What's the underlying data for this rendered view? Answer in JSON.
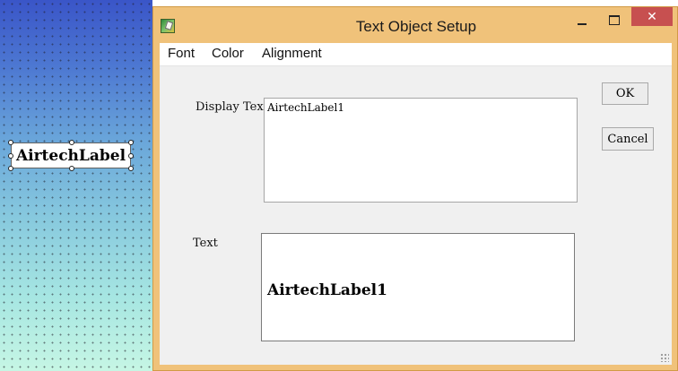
{
  "canvas": {
    "label_text": "AirtechLabel"
  },
  "window": {
    "title": "Text Object Setup",
    "close_glyph": "✕"
  },
  "menu": {
    "items": [
      "Font",
      "Color",
      "Alignment"
    ]
  },
  "form": {
    "display_text_label": "Display Text",
    "display_text_value": "AirtechLabel1",
    "text_label": "Text",
    "preview_value": "AirtechLabel1"
  },
  "buttons": {
    "ok": "OK",
    "cancel": "Cancel"
  },
  "colors": {
    "window_frame": "#f0c27a",
    "close_button": "#c75050",
    "canvas_top": "#3a55c8",
    "canvas_bottom": "#c6f6e4"
  }
}
